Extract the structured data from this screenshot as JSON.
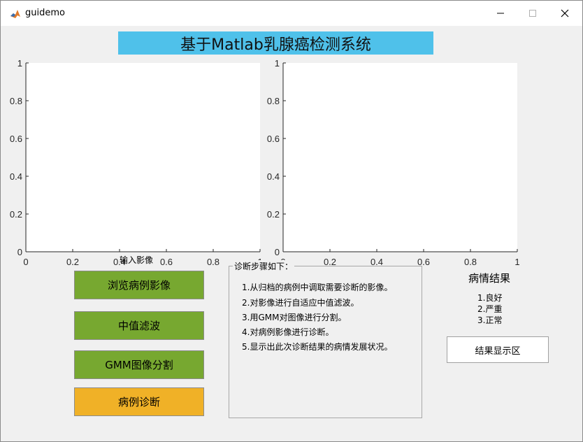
{
  "window": {
    "title": "guidemo"
  },
  "banner": {
    "title": "基于Matlab乳腺癌检测系统"
  },
  "axes1": {
    "yticks": [
      "0",
      "0.2",
      "0.4",
      "0.6",
      "0.8",
      "1"
    ],
    "xticks": [
      "0",
      "0.2",
      "0.4",
      "0.6",
      "0.8",
      "1"
    ],
    "caption": "输入影像"
  },
  "axes2": {
    "yticks": [
      "0",
      "0.2",
      "0.4",
      "0.6",
      "0.8",
      "1"
    ],
    "xticks": [
      "0",
      "0.2",
      "0.4",
      "0.6",
      "0.8",
      "1"
    ]
  },
  "buttons": {
    "browse": "浏览病例影像",
    "median": "中值滤波",
    "gmm": "GMM图像分割",
    "diagnose": "病例诊断"
  },
  "steps": {
    "title": "诊断步骤如下：",
    "items": [
      "1.从归档的病例中调取需要诊断的影像。",
      "2.对影像进行自适应中值滤波。",
      "3.用GMM对图像进行分割。",
      "4.对病例影像进行诊断。",
      "5.显示出此次诊断结果的病情发展状况。"
    ]
  },
  "result": {
    "title": "病情结果",
    "options": [
      "1.良好",
      "2.严重",
      "3.正常"
    ],
    "display": "结果显示区"
  },
  "colors": {
    "banner": "#4fc1ea",
    "button_green": "#77a830",
    "button_orange": "#f0b127"
  },
  "icons": {
    "app": "matlab-icon",
    "minimize": "minimize-icon",
    "maximize": "maximize-icon",
    "close": "close-icon"
  }
}
